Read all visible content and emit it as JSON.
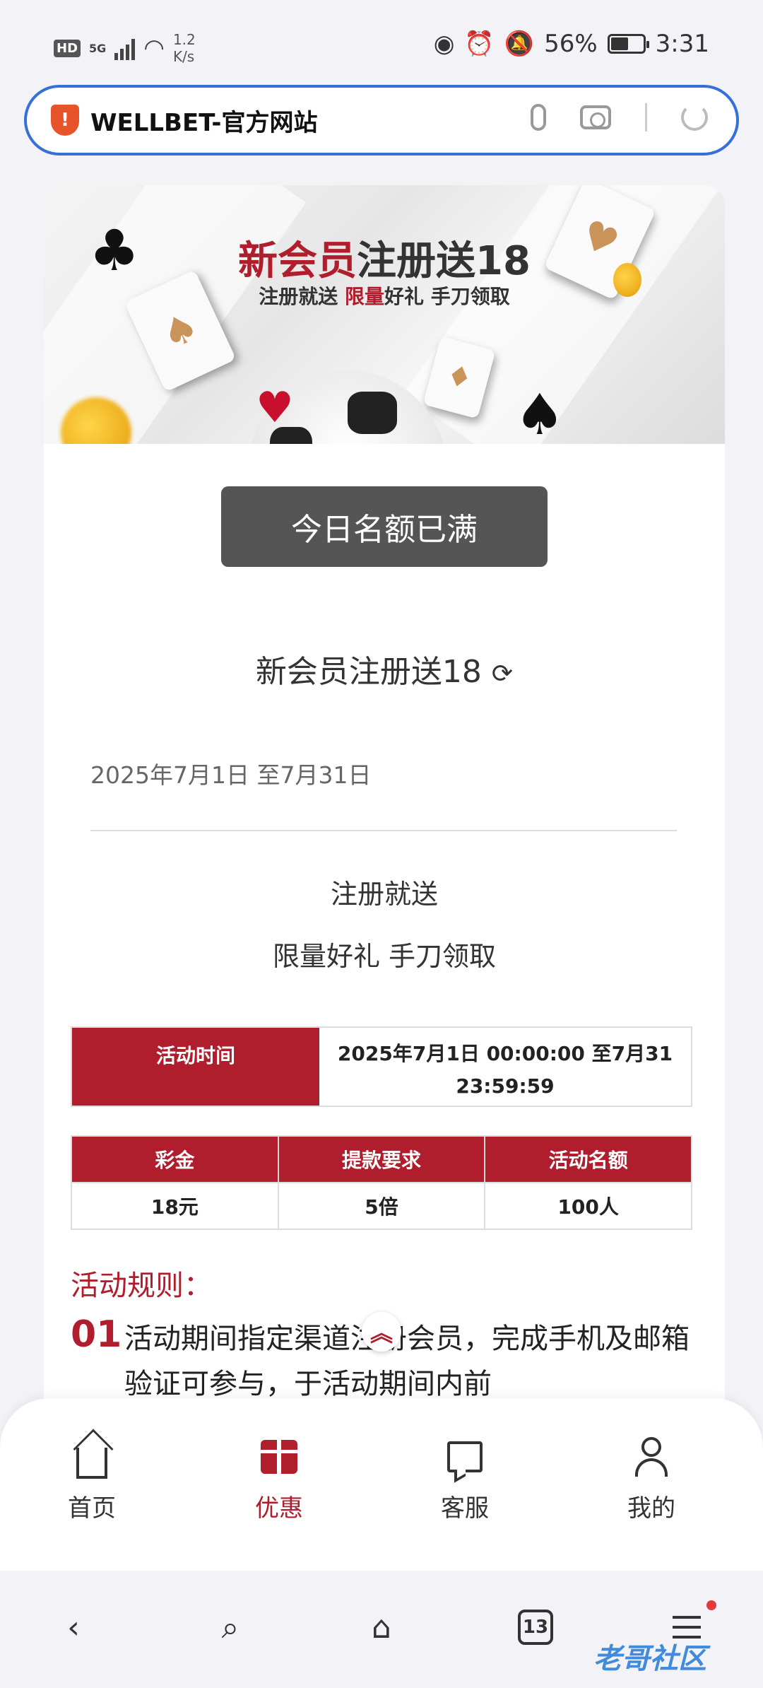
{
  "status_bar": {
    "hd": "HD",
    "network": "5G",
    "speed_value": "1.2",
    "speed_unit": "K/s",
    "battery": "56%",
    "battery_level": 0.56,
    "time": "3:31"
  },
  "address_bar": {
    "url_text": "WELLBET-官方网站",
    "shield_glyph": "!"
  },
  "banner": {
    "title_red": "新会员",
    "title_dark": "注册送18",
    "sub_dark1": "注册就送 ",
    "sub_red": "限量",
    "sub_dark2": "好礼 手刀领取"
  },
  "main": {
    "status_button": "今日名额已满",
    "event_title": "新会员注册送18",
    "event_date": "2025年7月1日 至7月31日",
    "desc_line1": "注册就送",
    "desc_line2": "限量好礼 手刀领取"
  },
  "time_table": {
    "label": "活动时间",
    "value": "2025年7月1日 00:00:00 至7月31 23:59:59"
  },
  "info_table": {
    "headers": [
      "彩金",
      "提款要求",
      "活动名额"
    ],
    "values": [
      "18元",
      "5倍",
      "100人"
    ]
  },
  "rules": {
    "title": "活动规则：",
    "items": [
      {
        "num": "01",
        "text": "活动期间指定渠道注册会员，完成手机及邮箱验证可参与，于活动期间内前"
      }
    ]
  },
  "site_nav": [
    {
      "label": "首页",
      "icon": "home-icon"
    },
    {
      "label": "优惠",
      "icon": "gift-icon"
    },
    {
      "label": "客服",
      "icon": "chat-icon"
    },
    {
      "label": "我的",
      "icon": "user-icon"
    }
  ],
  "browser_bar": {
    "tabs_count": "13",
    "watermark": "老哥社区"
  },
  "colors": {
    "brand_red": "#b01e2d",
    "address_border": "#3470d8",
    "button_gray": "#555555"
  }
}
